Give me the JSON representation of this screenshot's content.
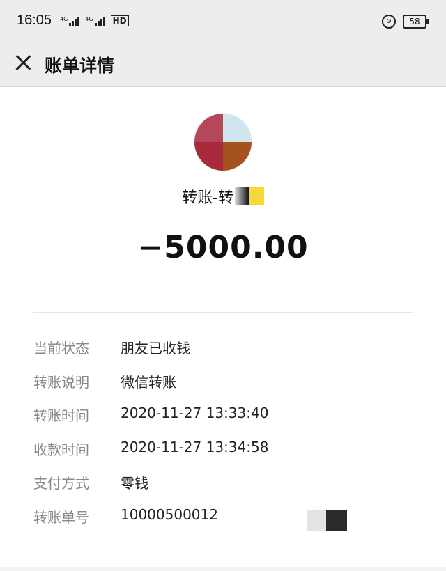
{
  "status_bar": {
    "time": "16:05",
    "battery": "58"
  },
  "header": {
    "title": "账单详情"
  },
  "transfer": {
    "name": "转账-转",
    "amount": "−5000.00"
  },
  "details": [
    {
      "label": "当前状态",
      "value": "朋友已收钱"
    },
    {
      "label": "转账说明",
      "value": "微信转账"
    },
    {
      "label": "转账时间",
      "value": "2020-11-27 13:33:40"
    },
    {
      "label": "收款时间",
      "value": "2020-11-27 13:34:58"
    },
    {
      "label": "支付方式",
      "value": "零钱"
    },
    {
      "label": "转账单号",
      "value": "10000500012"
    }
  ]
}
